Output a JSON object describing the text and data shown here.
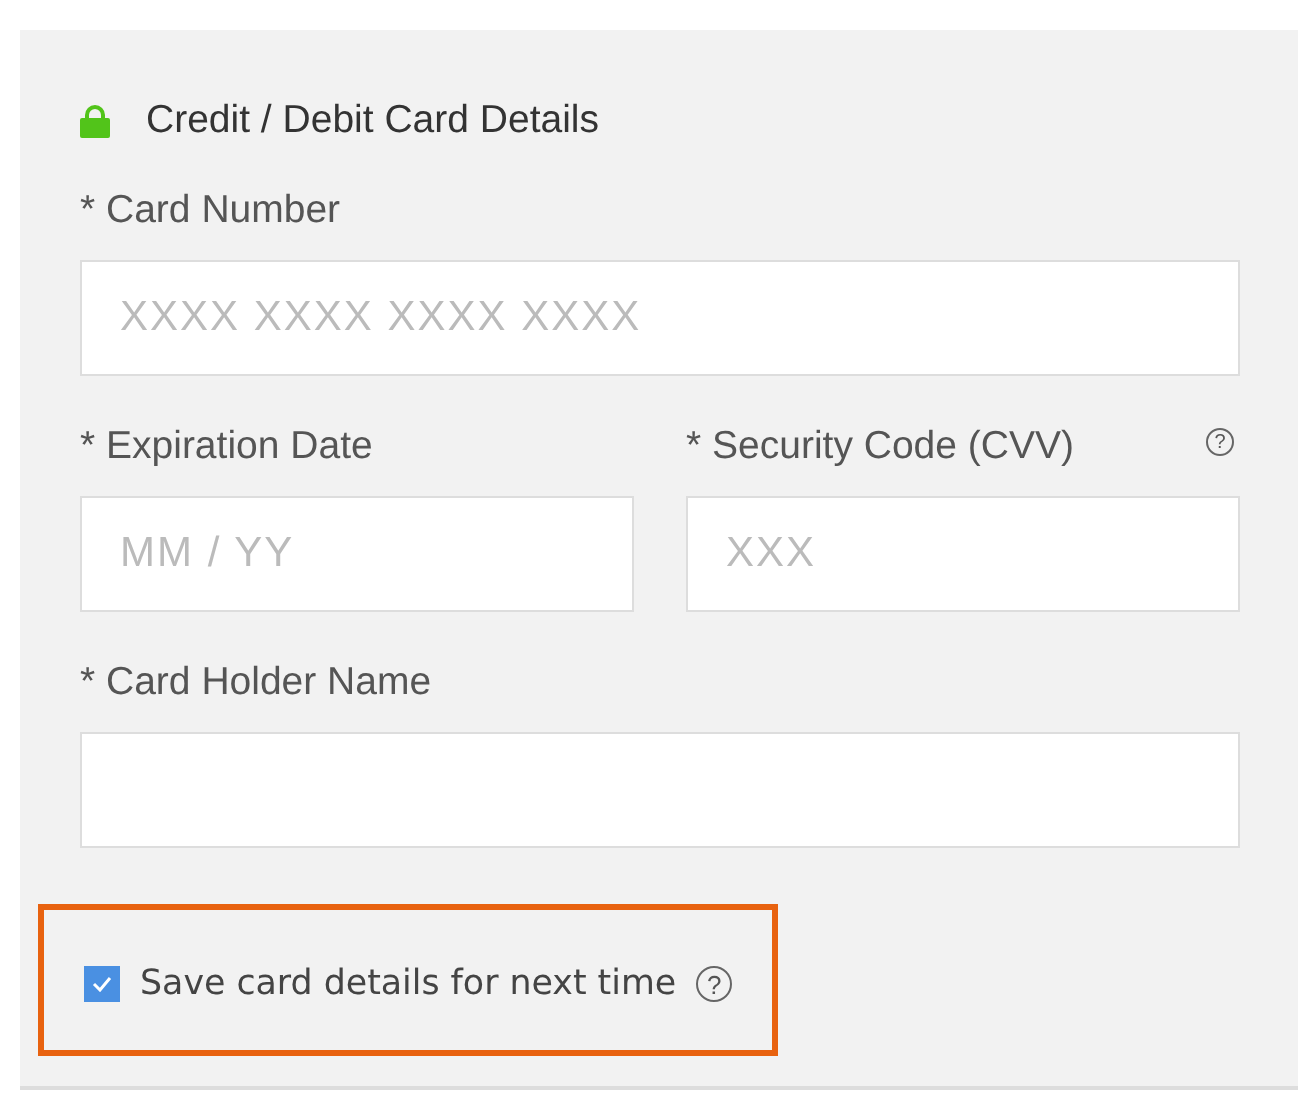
{
  "title": "Credit / Debit Card Details",
  "fields": [
    {
      "label": "* Card Number",
      "placeholder": "XXXX XXXX XXXX XXXX",
      "kind": "wide"
    },
    {
      "label": "* Expiration Date",
      "placeholder": "MM / YY",
      "kind": "narrow"
    },
    {
      "label": "* Security Code (CVV)",
      "placeholder": "XXX",
      "kind": "narrow",
      "help": "?"
    },
    {
      "label": "* Card Holder Name",
      "kind": "wide"
    }
  ],
  "save_option": {
    "label": "Save card details for next time",
    "checked": true,
    "help": "?",
    "highlighted": true
  }
}
